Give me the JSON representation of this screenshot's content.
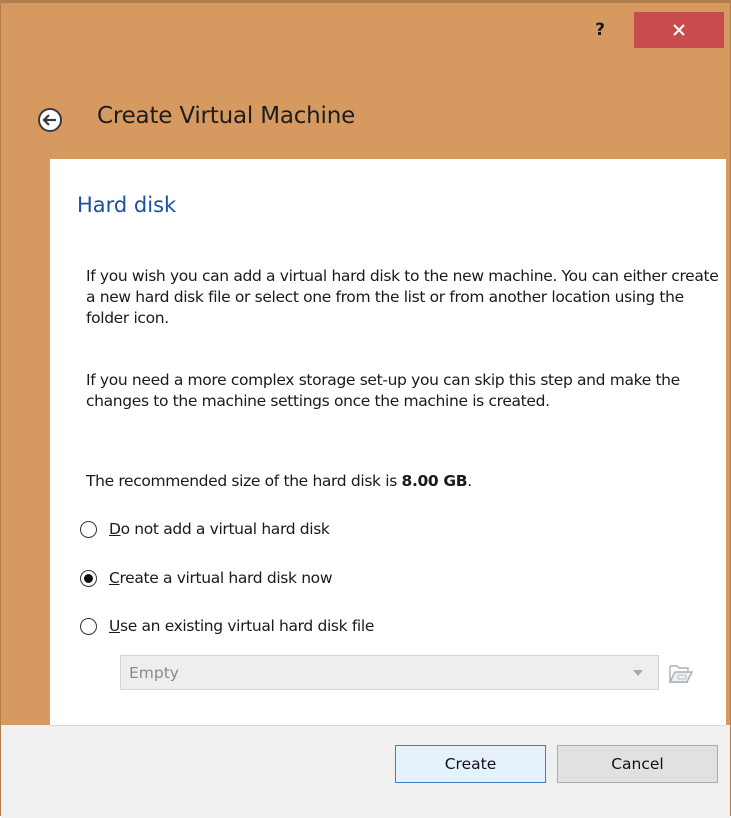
{
  "window": {
    "help_label": "?",
    "close_glyph": "✕",
    "accent_color": "#d69a61",
    "close_color": "#c84b4e"
  },
  "header": {
    "back_icon": "back-arrow-icon",
    "title": "Create Virtual Machine"
  },
  "page": {
    "title": "Hard disk",
    "paragraph1": "If you wish you can add a virtual hard disk to the new machine. You can either create a new hard disk file or select one from the list or from another location using the folder icon.",
    "paragraph2": "If you need a more complex storage set-up you can skip this step and make the changes to the machine settings once the machine is created.",
    "recommended_prefix": "The recommended size of the hard disk is ",
    "recommended_size": "8.00 GB",
    "recommended_suffix": "."
  },
  "options": [
    {
      "mnemonic": "D",
      "rest": "o not add a virtual hard disk",
      "selected": false
    },
    {
      "mnemonic": "C",
      "rest": "reate a virtual hard disk now",
      "selected": true
    },
    {
      "mnemonic": "U",
      "rest": "se an existing virtual hard disk file",
      "selected": false
    }
  ],
  "existing_disk": {
    "value": "Empty",
    "enabled": false,
    "folder_icon": "folder-open-icon"
  },
  "buttons": {
    "create": "Create",
    "cancel": "Cancel"
  }
}
